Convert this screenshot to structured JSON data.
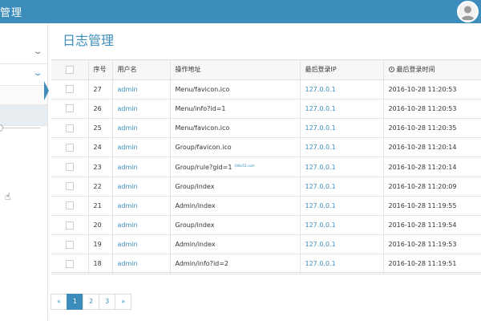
{
  "app": {
    "title": "管理"
  },
  "header": {
    "avatar_icon": "user-avatar-icon"
  },
  "sidebar": {
    "chevron": "⌄",
    "cursor": "☝"
  },
  "page": {
    "title": "日志管理"
  },
  "table": {
    "columns": [
      "",
      "序号",
      "用户名",
      "操作地址",
      "最后登录IP",
      "最后登录时间"
    ],
    "rows": [
      {
        "id": "27",
        "user": "admin",
        "url": "Menu/favicon.ico",
        "ip": "127.0.0.1",
        "time": "2016-10-28 11:20:53"
      },
      {
        "id": "26",
        "user": "admin",
        "url": "Menu/info?id=1",
        "ip": "127.0.0.1",
        "time": "2016-10-28 11:20:53"
      },
      {
        "id": "25",
        "user": "admin",
        "url": "Menu/favicon.ico",
        "ip": "127.0.0.1",
        "time": "2016-10-28 11:20:35"
      },
      {
        "id": "24",
        "user": "admin",
        "url": "Group/favicon.ico",
        "ip": "127.0.0.1",
        "time": "2016-10-28 11:20:14"
      },
      {
        "id": "23",
        "user": "admin",
        "url": "Group/rule?gid=1",
        "ip": "127.0.0.1",
        "time": "2016-10-28 11:20:14"
      },
      {
        "id": "22",
        "user": "admin",
        "url": "Group/index",
        "ip": "127.0.0.1",
        "time": "2016-10-28 11:20:09"
      },
      {
        "id": "21",
        "user": "admin",
        "url": "Admin/index",
        "ip": "127.0.0.1",
        "time": "2016-10-28 11:19:55"
      },
      {
        "id": "20",
        "user": "admin",
        "url": "Group/index",
        "ip": "127.0.0.1",
        "time": "2016-10-28 11:19:54"
      },
      {
        "id": "19",
        "user": "admin",
        "url": "Admin/index",
        "ip": "127.0.0.1",
        "time": "2016-10-28 11:19:53"
      },
      {
        "id": "18",
        "user": "admin",
        "url": "Admin/info?id=2",
        "ip": "127.0.0.1",
        "time": "2016-10-28 11:19:51"
      }
    ],
    "watermark": "Ohlle51.com"
  },
  "pagination": {
    "prev": "«",
    "pages": [
      "1",
      "2",
      "3"
    ],
    "next": "»",
    "current": "1"
  },
  "colors": {
    "primary": "#3c8dbc",
    "link": "#3c8dbc"
  }
}
